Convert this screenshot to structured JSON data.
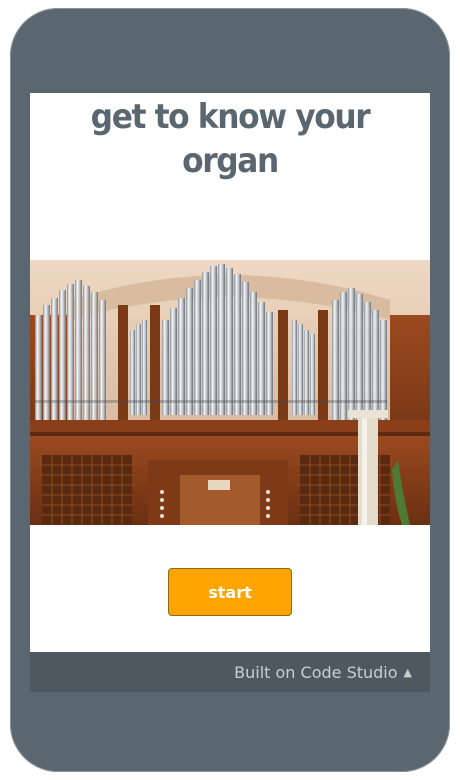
{
  "app": {
    "title": "get to know your organ",
    "start_label": "start"
  },
  "footer": {
    "label": "Built on Code Studio",
    "caret_icon": "caret-up-icon"
  },
  "colors": {
    "frame": "#5b6770",
    "footer_bg": "#4d5860",
    "button": "#ffa400",
    "title": "#5b6770"
  }
}
